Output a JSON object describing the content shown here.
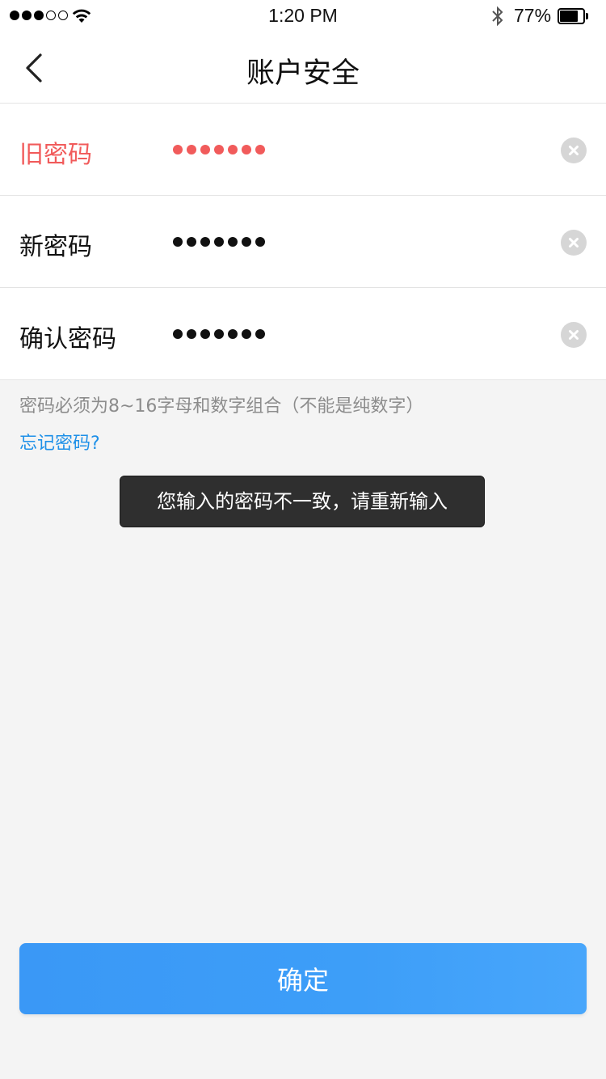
{
  "status_bar": {
    "time": "1:20 PM",
    "battery_percent": "77%",
    "battery_level": 0.77,
    "signal_bars_filled": 3,
    "signal_bars_total": 5,
    "icons": [
      "signal-dots-icon",
      "wifi-icon",
      "bluetooth-icon",
      "battery-icon"
    ]
  },
  "nav": {
    "title": "账户安全",
    "back_icon": "chevron-left-icon"
  },
  "form": {
    "rows": [
      {
        "label": "旧密码",
        "masked_length": 7,
        "state": "error",
        "clear_icon": "clear-icon"
      },
      {
        "label": "新密码",
        "masked_length": 7,
        "state": "normal",
        "clear_icon": "clear-icon"
      },
      {
        "label": "确认密码",
        "masked_length": 7,
        "state": "normal",
        "clear_icon": "clear-icon"
      }
    ]
  },
  "hint": "密码必须为8~16字母和数字组合（不能是纯数字）",
  "forgot_link": "忘记密码?",
  "toast": "您输入的密码不一致，请重新输入",
  "confirm_button": "确定",
  "colors": {
    "error": "#f15b5b",
    "link": "#1e90e8",
    "primary": "#3a98f6",
    "background": "#f4f4f4",
    "toast_bg": "#2f2f2f"
  }
}
